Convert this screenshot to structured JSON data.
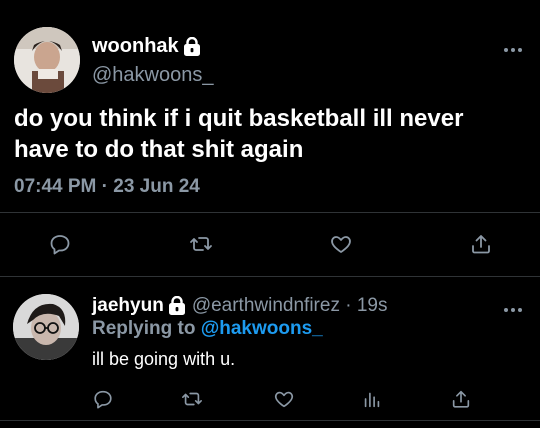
{
  "main_tweet": {
    "display_name": "woonhak",
    "handle": "@hakwoons_",
    "text": "do you think if i quit basketball ill never have to do that shit again",
    "timestamp": "07:44 PM · 23 Jun 24",
    "icons": [
      "lock-icon",
      "more-icon",
      "reply-icon",
      "retweet-icon",
      "like-icon",
      "share-icon"
    ]
  },
  "reply_tweet": {
    "display_name": "jaehyun",
    "handle_time": "@earthwindnfirez · 19s",
    "replying_prefix": "Replying to",
    "replying_handle": "@hakwoons_",
    "text": "ill be going with u.",
    "icons": [
      "lock-icon",
      "more-icon",
      "reply-icon",
      "retweet-icon",
      "like-icon",
      "analytics-icon",
      "share-icon"
    ]
  },
  "colors": {
    "background": "#000000",
    "text": "#ffffff",
    "secondary": "#8b98a5",
    "accent": "#1d9bf0",
    "divider": "#2f3336"
  }
}
